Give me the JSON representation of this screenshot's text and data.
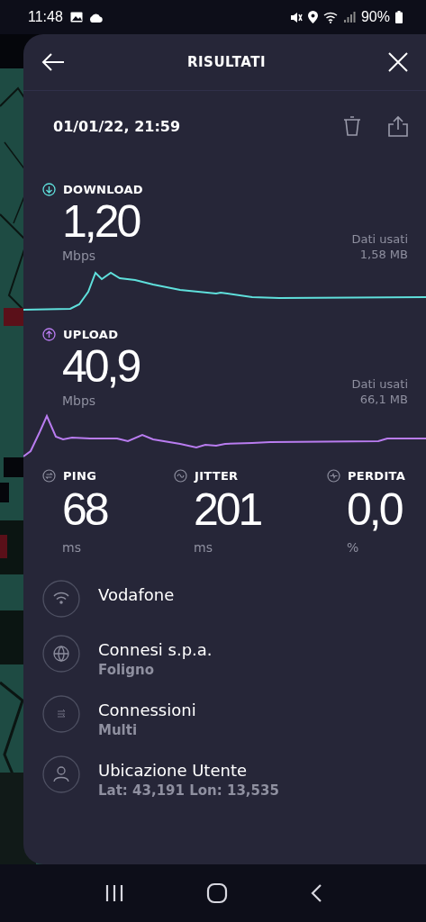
{
  "status_bar": {
    "time": "11:48",
    "battery": "90%"
  },
  "header": {
    "title": "RISULTATI"
  },
  "date": "01/01/22, 21:59",
  "speeds": [
    {
      "kind": "download",
      "label": "DOWNLOAD",
      "value": "1,20",
      "unit": "Mbps",
      "data_label": "Dati usati",
      "data_value": "1,58 MB"
    },
    {
      "kind": "upload",
      "label": "UPLOAD",
      "value": "40,9",
      "unit": "Mbps",
      "data_label": "Dati usati",
      "data_value": "66,1 MB"
    }
  ],
  "stats": [
    {
      "kind": "ping",
      "label": "PING",
      "value": "68",
      "unit": "ms"
    },
    {
      "kind": "jitter",
      "label": "JITTER",
      "value": "201",
      "unit": "ms"
    },
    {
      "kind": "loss",
      "label": "PERDITA",
      "value": "0,0",
      "unit": "%"
    }
  ],
  "details": [
    {
      "kind": "wifi",
      "title": "Vodafone"
    },
    {
      "kind": "globe",
      "title": "Connesi s.p.a.",
      "subtitle": "Foligno"
    },
    {
      "kind": "connections",
      "title": "Connessioni",
      "subtitle": "Multi"
    },
    {
      "kind": "user",
      "title": "Ubicazione Utente",
      "subtitle": "Lat: 43,191 Lon: 13,535"
    }
  ]
}
